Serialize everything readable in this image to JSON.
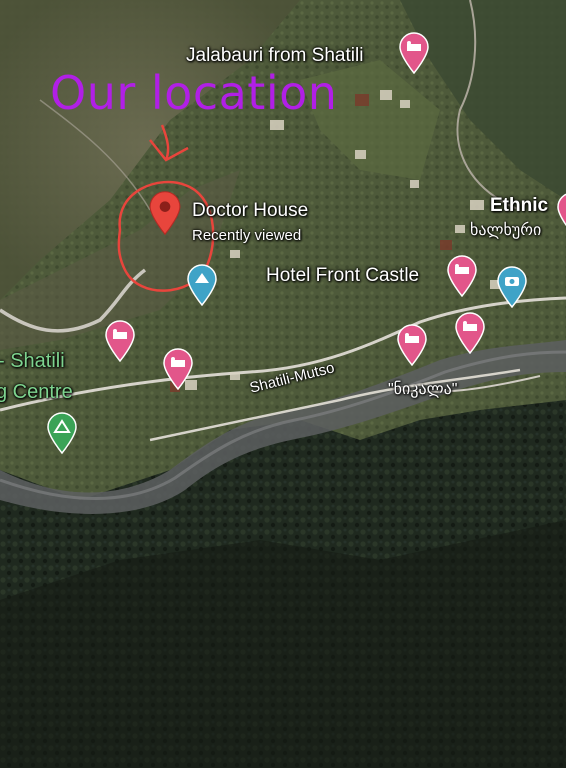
{
  "annotation": {
    "text": "Our location",
    "color": "#b11fe6",
    "marker_color": "#e8453c"
  },
  "places": {
    "jalabauri": "Jalabauri from Shatili",
    "doctor_house": "Doctor House",
    "recently_viewed": "Recently viewed",
    "hotel_front_castle": "Hotel Front Castle",
    "ethnic": "Ethnic",
    "ethnic_georgian": "ხალხური",
    "nikala": "\"ნიკალა\"",
    "shatili_partial": "- Shatili",
    "centre_partial": "g Centre",
    "road": "Shatili-Mutso"
  },
  "markers": {
    "hotel_color": "#e2568a",
    "attraction_color": "#3fa3c7",
    "park_color": "#3aa357",
    "location_color": "#e8453c"
  }
}
